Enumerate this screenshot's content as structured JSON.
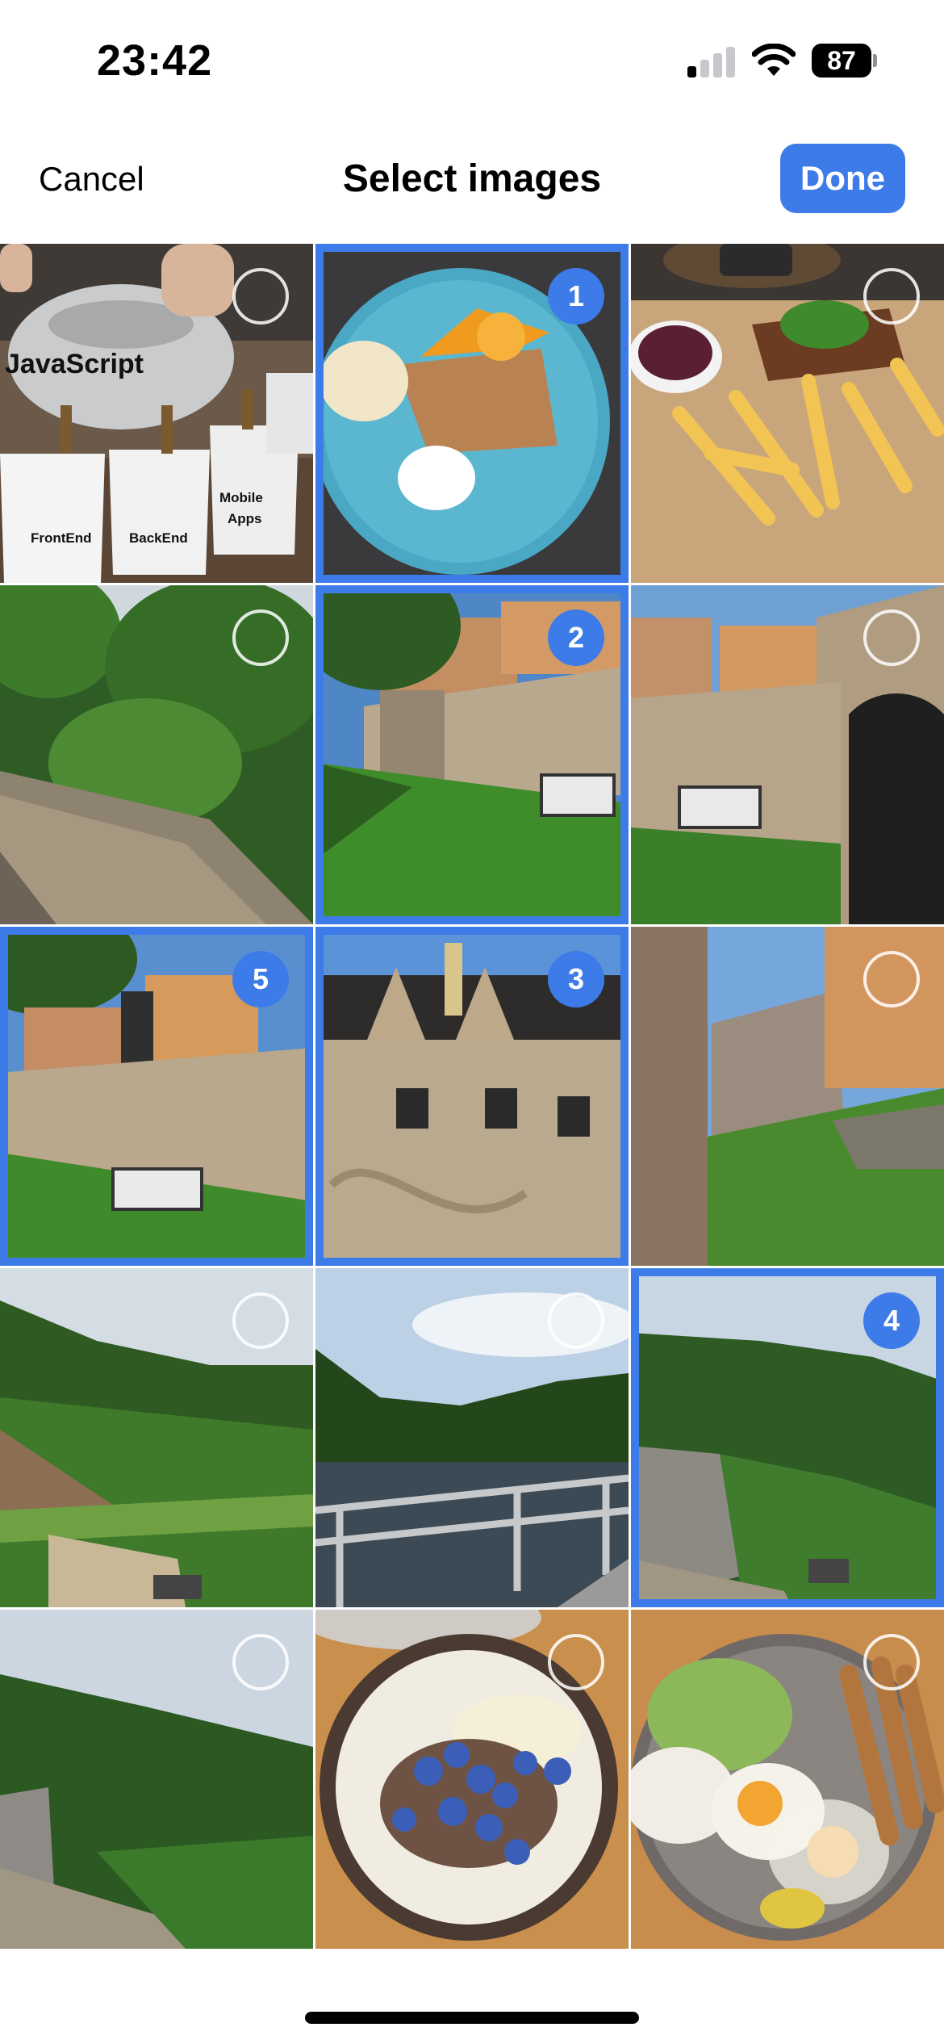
{
  "status_bar": {
    "time": "23:42",
    "battery": "87"
  },
  "nav": {
    "cancel_label": "Cancel",
    "title": "Select images",
    "done_label": "Done"
  },
  "tiles": [
    {
      "subject": "javascript-teapot-meme",
      "selected": false,
      "order": null,
      "text": {
        "heading": "JavaScript",
        "cup1": "FrontEnd",
        "cup2": "BackEnd",
        "cup3a": "Mobile",
        "cup3b": "Apps"
      }
    },
    {
      "subject": "dessert-plate-with-orange",
      "selected": true,
      "order": "1"
    },
    {
      "subject": "steak-and-fries",
      "selected": false,
      "order": null
    },
    {
      "subject": "forest-stone-wall",
      "selected": false,
      "order": null
    },
    {
      "subject": "castle-wall-and-lawn",
      "selected": true,
      "order": "2"
    },
    {
      "subject": "castle-gate-facade",
      "selected": false,
      "order": null
    },
    {
      "subject": "castle-wall-with-sign",
      "selected": true,
      "order": "5"
    },
    {
      "subject": "castle-building-facade",
      "selected": true,
      "order": "3"
    },
    {
      "subject": "castle-ruins-path",
      "selected": false,
      "order": null
    },
    {
      "subject": "valley-hills",
      "selected": false,
      "order": null
    },
    {
      "subject": "lake-with-railing",
      "selected": false,
      "order": null
    },
    {
      "subject": "dam-and-forest",
      "selected": true,
      "order": "4"
    },
    {
      "subject": "hills-and-dam-wall",
      "selected": false,
      "order": null
    },
    {
      "subject": "blueberry-bowl",
      "selected": false,
      "order": null
    },
    {
      "subject": "eggs-sausages-salad",
      "selected": false,
      "order": null
    }
  ],
  "colors": {
    "accent": "#3d7be8"
  }
}
